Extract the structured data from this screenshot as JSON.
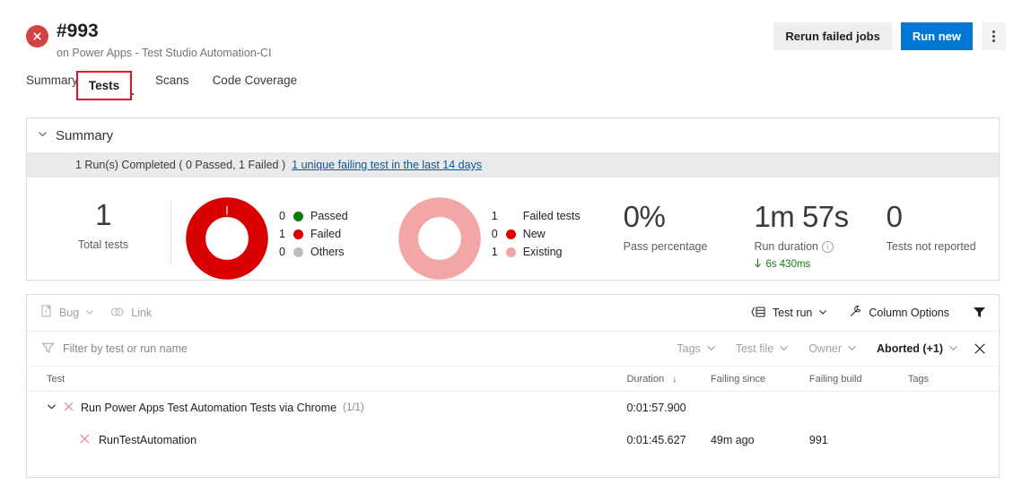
{
  "header": {
    "status_icon": "error-circle-icon",
    "build_id": "#993",
    "subtitle": "on Power Apps - Test Studio Automation-CI",
    "actions": {
      "rerun_label": "Rerun failed jobs",
      "run_new_label": "Run new",
      "more_label": "more-actions"
    }
  },
  "tabs": {
    "items": [
      {
        "label": "Summary",
        "active": false
      },
      {
        "label": "Tests",
        "active": true
      },
      {
        "label": "Scans",
        "active": false
      },
      {
        "label": "Code Coverage",
        "active": false
      }
    ],
    "highlight_label": "Tests",
    "highlight_color": "#e81123"
  },
  "summary": {
    "title": "Summary",
    "chevron": "chevron-down-icon",
    "status_line": "1 Run(s) Completed ( 0 Passed, 1 Failed )",
    "link_text": "1 unique failing test in the last 14 days",
    "total": {
      "value": "1",
      "label": "Total tests"
    },
    "outcome_donut": {
      "colors": {
        "passed": "#107c10",
        "failed": "#d80000",
        "others": "#bdbdbd"
      },
      "segments": [
        {
          "name": "Passed",
          "count": "0",
          "value": 0,
          "color": "#107c10"
        },
        {
          "name": "Failed",
          "count": "1",
          "value": 1,
          "color": "#d80000"
        },
        {
          "name": "Others",
          "count": "0",
          "value": 0,
          "color": "#bdbdbd"
        }
      ]
    },
    "failed_donut": {
      "header": {
        "count": "1",
        "label": "Failed tests"
      },
      "segments": [
        {
          "name": "New",
          "count": "0",
          "value": 0,
          "color": "#e00000"
        },
        {
          "name": "Existing",
          "count": "1",
          "value": 1,
          "color": "#f4a6a6"
        }
      ]
    },
    "pass_percentage": {
      "value": "0%",
      "label": "Pass percentage"
    },
    "run_duration": {
      "value": "1m 57s",
      "label": "Run duration",
      "info_icon": "info-icon",
      "trend": "6s 430ms",
      "trend_icon": "arrow-down-icon",
      "trend_color": "#107c10"
    },
    "not_reported": {
      "value": "0",
      "label": "Tests not reported"
    }
  },
  "results": {
    "toolbar": {
      "bug": {
        "label": "Bug",
        "icon": "bug-report-icon",
        "chevron": "chevron-down-icon"
      },
      "link": {
        "label": "Link",
        "icon": "link-icon"
      },
      "test_run": {
        "label": "Test run",
        "icon": "group-by-icon",
        "chevron": "chevron-down-icon"
      },
      "column_options": {
        "label": "Column Options",
        "icon": "wrench-icon"
      },
      "filter": {
        "label": "filter",
        "icon": "funnel-filled-icon"
      }
    },
    "filterbar": {
      "search_placeholder": "Filter by test or run name",
      "search_value": "",
      "search_icon": "funnel-icon",
      "pills": [
        {
          "label": "Tags",
          "strong": false
        },
        {
          "label": "Test file",
          "strong": false
        },
        {
          "label": "Owner",
          "strong": false
        },
        {
          "label": "Aborted (+1)",
          "strong": true
        }
      ],
      "clear_icon": "close-icon"
    },
    "table": {
      "columns": [
        "Test",
        "Duration",
        "Failing since",
        "Failing build",
        "Tags"
      ],
      "sort_column": "Duration",
      "sort_icon": "arrow-down-icon",
      "rows": [
        {
          "type": "group",
          "expand_icon": "chevron-down-icon",
          "status_icon": "failed-x-icon",
          "name": "Run Power Apps Test Automation Tests via Chrome",
          "count": "(1/1)",
          "duration": "0:01:57.900",
          "failing_since": "",
          "failing_build": "",
          "tags": ""
        },
        {
          "type": "test",
          "status_icon": "failed-x-icon",
          "name": "RunTestAutomation",
          "duration": "0:01:45.627",
          "failing_since": "49m ago",
          "failing_build": "991",
          "tags": ""
        }
      ]
    }
  }
}
